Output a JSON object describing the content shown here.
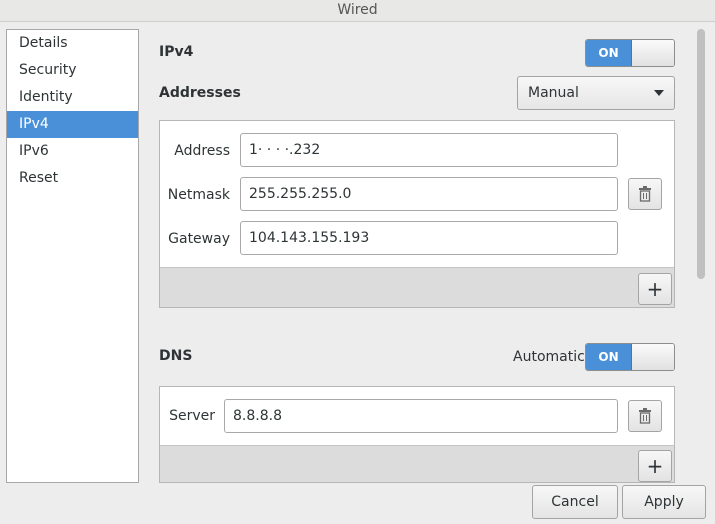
{
  "window": {
    "title": "Wired"
  },
  "sidebar": {
    "items": [
      {
        "label": "Details"
      },
      {
        "label": "Security"
      },
      {
        "label": "Identity"
      },
      {
        "label": "IPv4",
        "selected": true
      },
      {
        "label": "IPv6"
      },
      {
        "label": "Reset"
      }
    ]
  },
  "ipv4": {
    "title": "IPv4",
    "toggle_label": "ON",
    "addresses_title": "Addresses",
    "method_selected": "Manual",
    "address_label": "Address",
    "address_value": "1·  ·      ·    ·.232",
    "netmask_label": "Netmask",
    "netmask_value": "255.255.255.0",
    "gateway_label": "Gateway",
    "gateway_value": "104.143.155.193"
  },
  "dns": {
    "title": "DNS",
    "automatic_label": "Automatic",
    "toggle_label": "ON",
    "server_label": "Server",
    "server_value": "8.8.8.8"
  },
  "actions": {
    "cancel_label": "Cancel",
    "apply_label": "Apply"
  },
  "colors": {
    "accent": "#4a90d9"
  }
}
